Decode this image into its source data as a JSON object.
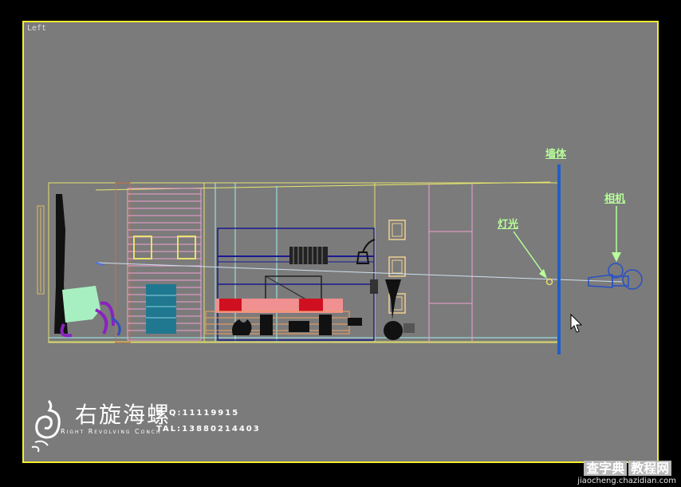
{
  "viewport": {
    "label": "Left"
  },
  "annotations": {
    "wall": "墙体",
    "light": "灯光",
    "camera": "相机"
  },
  "logo": {
    "brand_cn": "右旋海螺",
    "brand_en": "Right Revolving Conch",
    "qq": "Q Q:11119915",
    "tel": "TAL:13880214403"
  },
  "watermark": {
    "site": "查字典",
    "badge": "教程网",
    "url": "jiaocheng.chazidian.com"
  },
  "colors": {
    "viewport_border": "#f2ef2e",
    "viewport_bg": "#7b7b7b",
    "wall": "#1e5fc8",
    "annotation": "#b8ff9a"
  }
}
